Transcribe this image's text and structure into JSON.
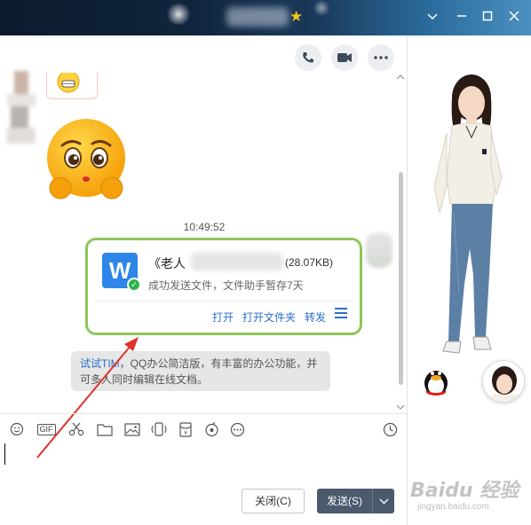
{
  "window": {
    "controls": [
      "chevron-down-icon",
      "minimize-icon",
      "maximize-icon",
      "close-icon"
    ]
  },
  "header_actions": [
    "phone-icon",
    "video-icon",
    "more-icon"
  ],
  "chat": {
    "timestamp": "10:49:52",
    "file_message": {
      "name_prefix": "《老人",
      "size": "(28.07KB)",
      "status": "成功发送文件，文件助手暂存7天",
      "actions": {
        "open": "打开",
        "open_folder": "打开文件夹",
        "forward": "转发"
      },
      "icon_letter": "W"
    },
    "tip": {
      "link": "试试TIM",
      "text": "，QQ办公简洁版，有丰富的办公功能，并可多人同时编辑在线文档。"
    }
  },
  "toolbar": {
    "gif_label": "GIF",
    "tools": [
      "emoji-icon",
      "gif-icon",
      "scissors-icon",
      "folder-icon",
      "image-icon",
      "shake-icon",
      "red-packet-icon",
      "music-icon",
      "more-icon",
      "history-icon"
    ]
  },
  "buttons": {
    "close": "关闭(C)",
    "send": "发送(S)"
  },
  "watermark": {
    "main": "Baidu 经验",
    "sub": "jingyan.baidu.com"
  },
  "colors": {
    "bubble_border": "#8ec65a",
    "link": "#2a6fcc",
    "send_button": "#4b5a6c",
    "word_icon": "#2d86e8"
  }
}
